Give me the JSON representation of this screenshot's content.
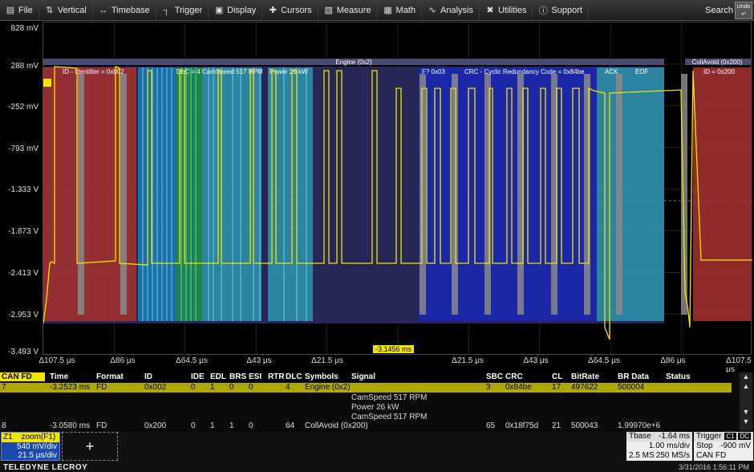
{
  "menu": [
    {
      "label": "File",
      "icon": "file-icon",
      "glyph": "▤"
    },
    {
      "label": "Vertical",
      "icon": "vertical-icon",
      "glyph": "⇅"
    },
    {
      "label": "Timebase",
      "icon": "timebase-icon",
      "glyph": "↔"
    },
    {
      "label": "Trigger",
      "icon": "trigger-icon",
      "glyph": "┐"
    },
    {
      "label": "Display",
      "icon": "display-icon",
      "glyph": "▣"
    },
    {
      "label": "Cursors",
      "icon": "cursors-icon",
      "glyph": "✚"
    },
    {
      "label": "Measure",
      "icon": "measure-icon",
      "glyph": "▧"
    },
    {
      "label": "Math",
      "icon": "math-icon",
      "glyph": "▦"
    },
    {
      "label": "Analysis",
      "icon": "analysis-icon",
      "glyph": "∿"
    },
    {
      "label": "Utilities",
      "icon": "utilities-icon",
      "glyph": "✖"
    },
    {
      "label": "Support",
      "icon": "support-icon",
      "glyph": "ⓘ"
    }
  ],
  "search_label": "Search",
  "undo_label": "Undo",
  "y_labels": [
    "828 mV",
    "288 mV",
    "-252 mV",
    "-793 mV",
    "-1.333 V",
    "-1.873 V",
    "-2.413 V",
    "-2.953 V",
    "-3.493 V"
  ],
  "x_labels": [
    "Δ107.5 μs",
    "Δ86 μs",
    "Δ64.5 μs",
    "Δ43 μs",
    "Δ21.5 μs",
    "Δ21.5 μs",
    "Δ43 μs",
    "Δ64.5 μs",
    "Δ86 μs",
    "Δ107.5 μs"
  ],
  "trigger_time": "-3.1456 ms",
  "decode_labels": {
    "frame1": "Engine (0x2)",
    "frame2": "CollAvoid (0x200)",
    "id1": "ID - Identifier = 0x002",
    "dlc": "DLC = 4",
    "camspeed": "CamSpeed 517 RPM",
    "power": "Power 26 kW",
    "f": "F? 0x03",
    "crc": "CRC - Cyclic Redundancy Code = 0x84be",
    "ack": "ACK",
    "eof": "EOF",
    "id2": "ID = 0x200"
  },
  "colors": {
    "id": "#a03030",
    "dlc_blue": "#1e78b0",
    "dlc_green": "#209040",
    "data_teal": "#2f8fa8",
    "frame_bg": "#2a2a60",
    "crc_blue": "#1c28b0",
    "gray_bar": "#8a8a8a",
    "ack": "#2f8fa8",
    "trace": "#f2e600"
  },
  "table": {
    "headers": [
      "CAN FD",
      "Time",
      "Format",
      "ID",
      "IDE",
      "EDL",
      "BRS",
      "ESI",
      "RTR",
      "DLC",
      "Symbols",
      "Signal",
      "SBC",
      "CRC",
      "CL",
      "BitRate",
      "BR Data",
      "Status"
    ],
    "row1": [
      "7",
      "-3.2523 ms",
      "FD",
      "0x002",
      "0",
      "1",
      "0",
      "0",
      "",
      "4",
      "Engine  (0x2)",
      "",
      "3",
      "0x84be",
      "17",
      "497622",
      "500004",
      ""
    ],
    "sig1": "CamSpeed 517 RPM",
    "sig2": "Power 26 kW",
    "sig3": "CamSpeed 517 RPM",
    "row2": [
      "8",
      "-3.0580 ms",
      "FD",
      "0x200",
      "0",
      "1",
      "1",
      "0",
      "",
      "64",
      "CollAvoid  (0x200)",
      "",
      "65",
      "0x18f75d",
      "21",
      "500043",
      "1.99970e+6",
      ""
    ]
  },
  "z1": {
    "title": "Z1",
    "source": "zoom(F1)",
    "vdiv": "540 mV/div",
    "tdiv": "21.5 μs/div"
  },
  "add": "+",
  "tbase": {
    "label": "Tbase",
    "value": "-1.64 ms",
    "div": "1.00 ms/div",
    "samples": "2.5 MS",
    "rate": "250 MS/s"
  },
  "trigger": {
    "label": "Trigger",
    "c1": "C1",
    "dc": "DC",
    "mode": "Stop",
    "level": "-900 mV",
    "type": "CAN FD"
  },
  "brand": "TELEDYNE LECROY",
  "datetime": "3/31/2016 1:56:11 PM"
}
